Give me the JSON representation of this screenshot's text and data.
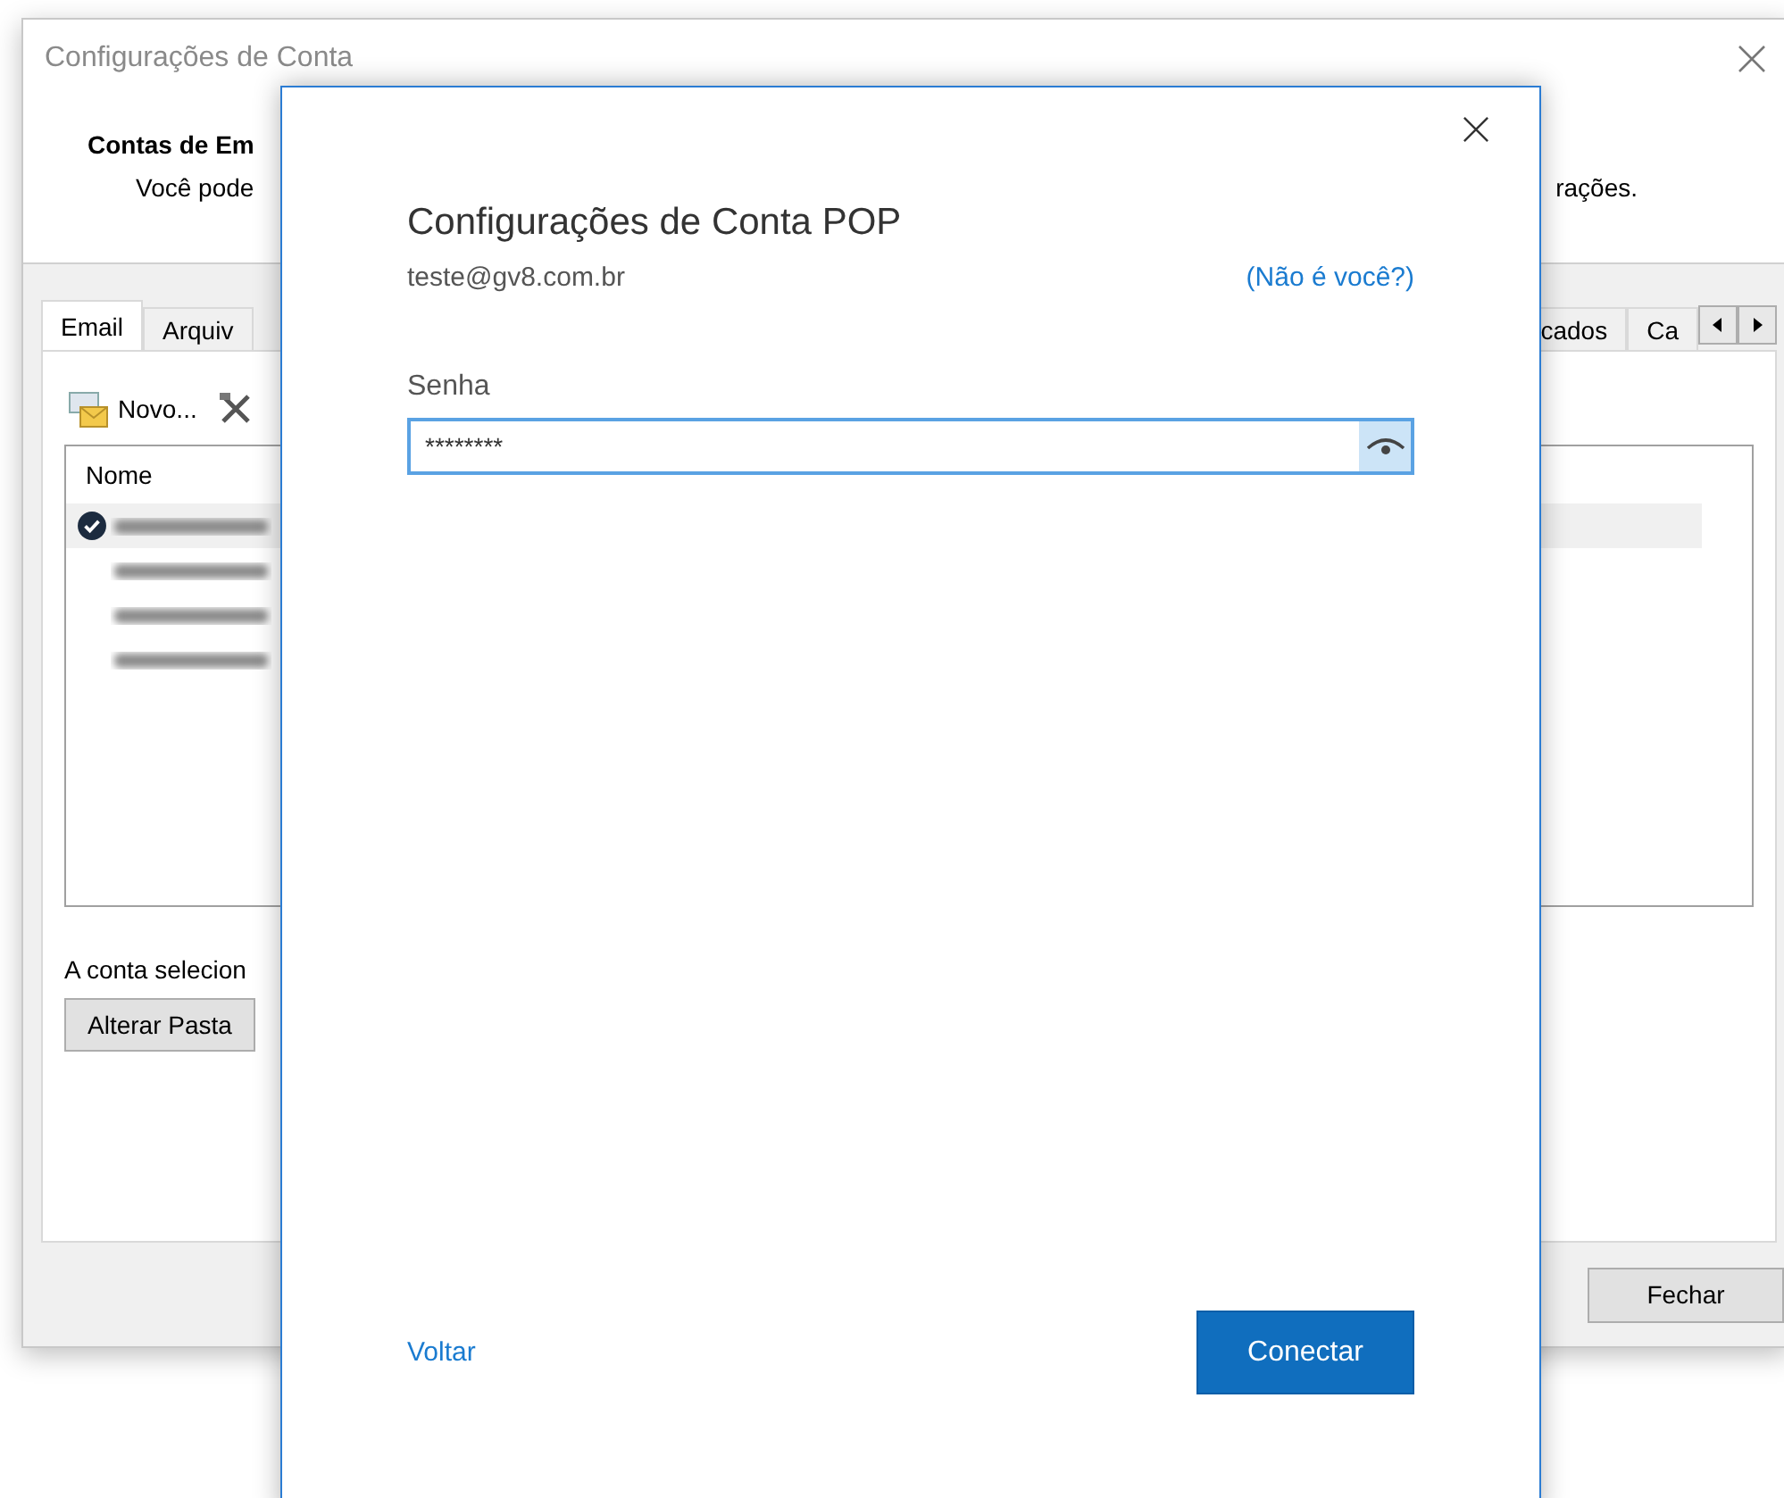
{
  "background_window": {
    "title": "Configurações de Conta",
    "heading": "Contas de Em",
    "description": "Você pode",
    "description_end": "rações.",
    "tabs_start": [
      {
        "label": "Email",
        "selected": true
      },
      {
        "label": "Arquiv",
        "selected": false
      }
    ],
    "tabs_end": [
      {
        "label": "cados",
        "selected": false
      },
      {
        "label": "Ca",
        "selected": false
      }
    ],
    "toolbar": {
      "new_button": "Novo..."
    },
    "account_list": {
      "column": "Nome",
      "rows": [
        {
          "default": true,
          "selected": true
        },
        {
          "default": false,
          "selected": false
        },
        {
          "default": false,
          "selected": false
        },
        {
          "default": false,
          "selected": false
        }
      ]
    },
    "selected_account_text": "A conta selecion",
    "change_folder_button": "Alterar Pasta",
    "close_button": "Fechar"
  },
  "dialog": {
    "title": "Configurações de Conta POP",
    "email": "teste@gv8.com.br",
    "not_you_link": "(Não é você?)",
    "password_label": "Senha",
    "password_value": "********",
    "back_link": "Voltar",
    "connect_button": "Conectar"
  }
}
